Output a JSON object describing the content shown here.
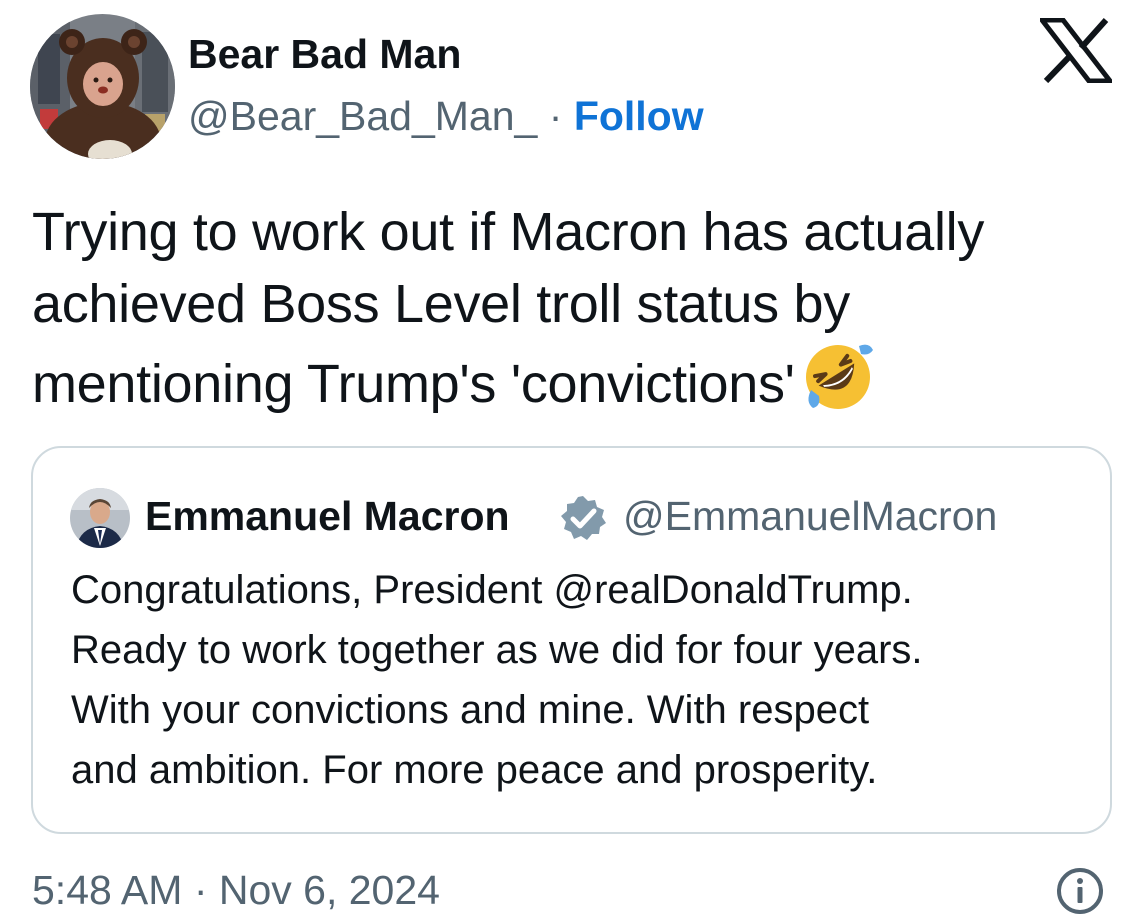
{
  "author": {
    "display_name": "Bear Bad Man",
    "handle": "@Bear_Bad_Man_",
    "separator": "·",
    "follow_label": "Follow"
  },
  "brand": {
    "logo_icon": "x-logo-icon"
  },
  "tweet": {
    "text": "Trying to work out if Macron has actually achieved Boss Level troll status by mentioning Trump's 'convictions'",
    "emoji": "rolling-on-the-floor-laughing-emoji"
  },
  "quoted_tweet": {
    "display_name": "Emmanuel Macron",
    "handle": "@EmmanuelMacron",
    "verified_icon": "verified-badge-icon",
    "lines": [
      "Congratulations, President @realDonaldTrump.",
      "Ready to work together as we did for four years.",
      "With your convictions and mine. With respect",
      "and ambition. For more peace and prosperity."
    ]
  },
  "meta": {
    "timestamp": "5:48 AM · Nov 6, 2024",
    "info_icon": "info-icon"
  },
  "colors": {
    "text_primary": "#0f1419",
    "text_secondary": "#536471",
    "link": "#0f73d6",
    "border": "#cfd9de",
    "verified": "#829aab"
  }
}
